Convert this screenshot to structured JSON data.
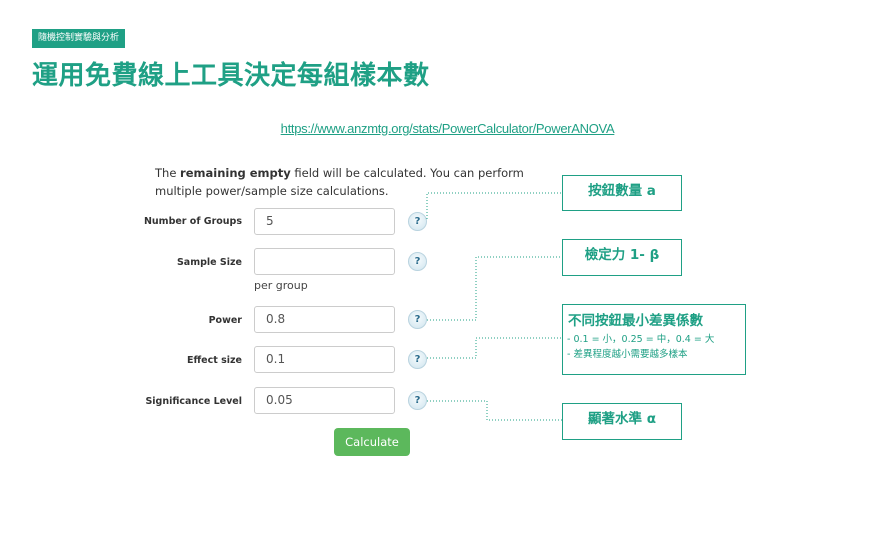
{
  "header": {
    "tag": "隨機控制實驗與分析",
    "title": "運用免費線上工具決定每組樣本數"
  },
  "link": {
    "url_text": "https://www.anzmtg.org/stats/PowerCalculator/PowerANOVA"
  },
  "form": {
    "intro": {
      "prefix": "The ",
      "bold": "remaining empty",
      "suffix": " field will be calculated. You can perform",
      "line2": "multiple power/sample size calculations."
    },
    "fields": [
      {
        "label": "Number of Groups",
        "value": "5"
      },
      {
        "label": "Sample Size",
        "value": "",
        "note": "per group"
      },
      {
        "label": "Power",
        "value": "0.8"
      },
      {
        "label": "Effect size",
        "value": "0.1"
      },
      {
        "label": "Significance Level",
        "value": "0.05"
      }
    ],
    "help_symbol": "?",
    "calculate_label": "Calculate"
  },
  "callouts": {
    "groups": "按鈕數量 a",
    "power": "檢定力 1- β",
    "effect": {
      "title": "不同按鈕最小差異係數",
      "line1": "- 0.1 = 小，0.25 = 中，0.4 = 大",
      "line2": "- 差異程度越小需要越多樣本"
    },
    "alpha": "顯著水準 α"
  },
  "colors": {
    "accent": "#1fa085",
    "button": "#5cb85c"
  }
}
